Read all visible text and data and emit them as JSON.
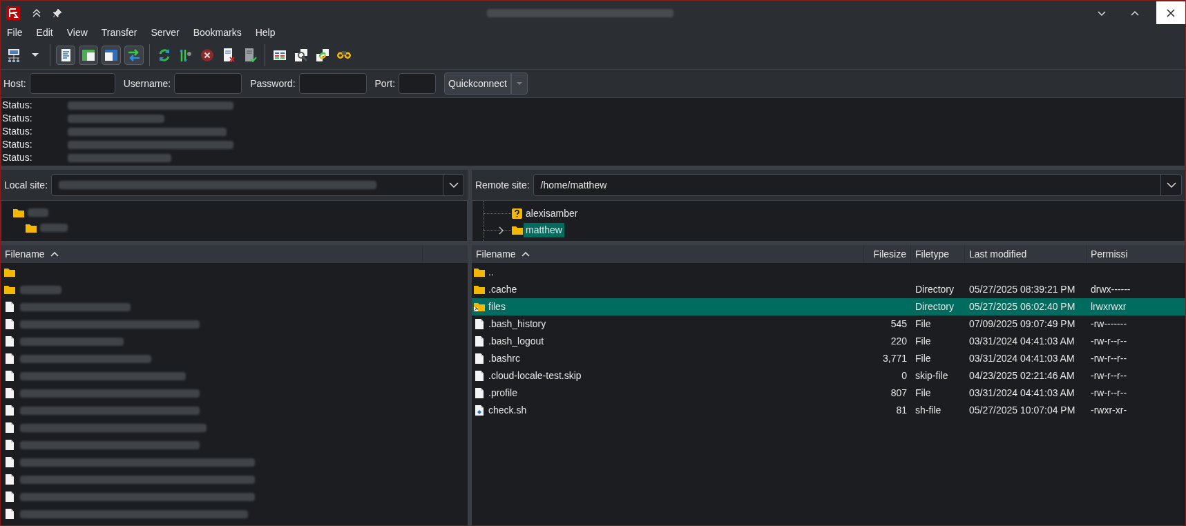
{
  "menu": [
    "File",
    "Edit",
    "View",
    "Transfer",
    "Server",
    "Bookmarks",
    "Help"
  ],
  "toolbar": [
    {
      "kind": "sitemanager",
      "toggled": false
    },
    {
      "kind": "dropdown",
      "toggled": false
    },
    {
      "kind": "log",
      "toggled": true
    },
    {
      "kind": "localtree",
      "toggled": true
    },
    {
      "kind": "remotetree",
      "toggled": true
    },
    {
      "kind": "queue",
      "toggled": true
    },
    {
      "kind": "refresh",
      "toggled": false
    },
    {
      "kind": "filter",
      "toggled": false
    },
    {
      "kind": "cancel",
      "toggled": false
    },
    {
      "kind": "disconnect",
      "toggled": false
    },
    {
      "kind": "reconnect",
      "toggled": false
    },
    {
      "kind": "compare",
      "toggled": false
    },
    {
      "kind": "sync",
      "toggled": false
    },
    {
      "kind": "recursive",
      "toggled": false
    },
    {
      "kind": "find",
      "toggled": false
    }
  ],
  "quickconnect": {
    "fields": [
      {
        "label": "Host:"
      },
      {
        "label": "Username:"
      },
      {
        "label": "Password:"
      },
      {
        "label": "Port:"
      }
    ],
    "button": "Quickconnect"
  },
  "log": [
    "Status:",
    "Status:",
    "Status:",
    "Status:",
    "Status:"
  ],
  "local_site": {
    "label": "Local site:"
  },
  "remote_site": {
    "label": "Remote site:",
    "path": "/home/matthew"
  },
  "remote_tree": [
    {
      "name": "alexisamber",
      "kind": "unknown",
      "selected": false
    },
    {
      "name": "matthew",
      "kind": "folder",
      "selected": true
    }
  ],
  "local_list": {
    "columns": [
      "Filename"
    ]
  },
  "remote_list": {
    "columns": [
      "Filename",
      "Filesize",
      "Filetype",
      "Last modified",
      "Permissi"
    ],
    "rows": [
      {
        "kind": "folder",
        "name": "..",
        "size": "",
        "type": "",
        "modified": "",
        "perms": "",
        "selected": false
      },
      {
        "kind": "folder",
        "name": ".cache",
        "size": "",
        "type": "Directory",
        "modified": "05/27/2025 08:39:21 PM",
        "perms": "drwx------",
        "selected": false
      },
      {
        "kind": "link",
        "name": "files",
        "size": "",
        "type": "Directory",
        "modified": "05/27/2025 06:02:40 PM",
        "perms": "lrwxrwxr",
        "selected": true
      },
      {
        "kind": "file",
        "name": ".bash_history",
        "size": "545",
        "type": "File",
        "modified": "07/09/2025 09:07:49 PM",
        "perms": "-rw-------",
        "selected": false
      },
      {
        "kind": "file",
        "name": ".bash_logout",
        "size": "220",
        "type": "File",
        "modified": "03/31/2024 04:41:03 AM",
        "perms": "-rw-r--r--",
        "selected": false
      },
      {
        "kind": "file",
        "name": ".bashrc",
        "size": "3,771",
        "type": "File",
        "modified": "03/31/2024 04:41:03 AM",
        "perms": "-rw-r--r--",
        "selected": false
      },
      {
        "kind": "file",
        "name": ".cloud-locale-test.skip",
        "size": "0",
        "type": "skip-file",
        "modified": "04/23/2025 02:21:46 AM",
        "perms": "-rw-r--r--",
        "selected": false
      },
      {
        "kind": "file",
        "name": ".profile",
        "size": "807",
        "type": "File",
        "modified": "03/31/2024 04:41:03 AM",
        "perms": "-rw-r--r--",
        "selected": false
      },
      {
        "kind": "script",
        "name": "check.sh",
        "size": "81",
        "type": "sh-file",
        "modified": "05/27/2025 10:07:04 PM",
        "perms": "-rwxr-xr-",
        "selected": false
      }
    ]
  }
}
